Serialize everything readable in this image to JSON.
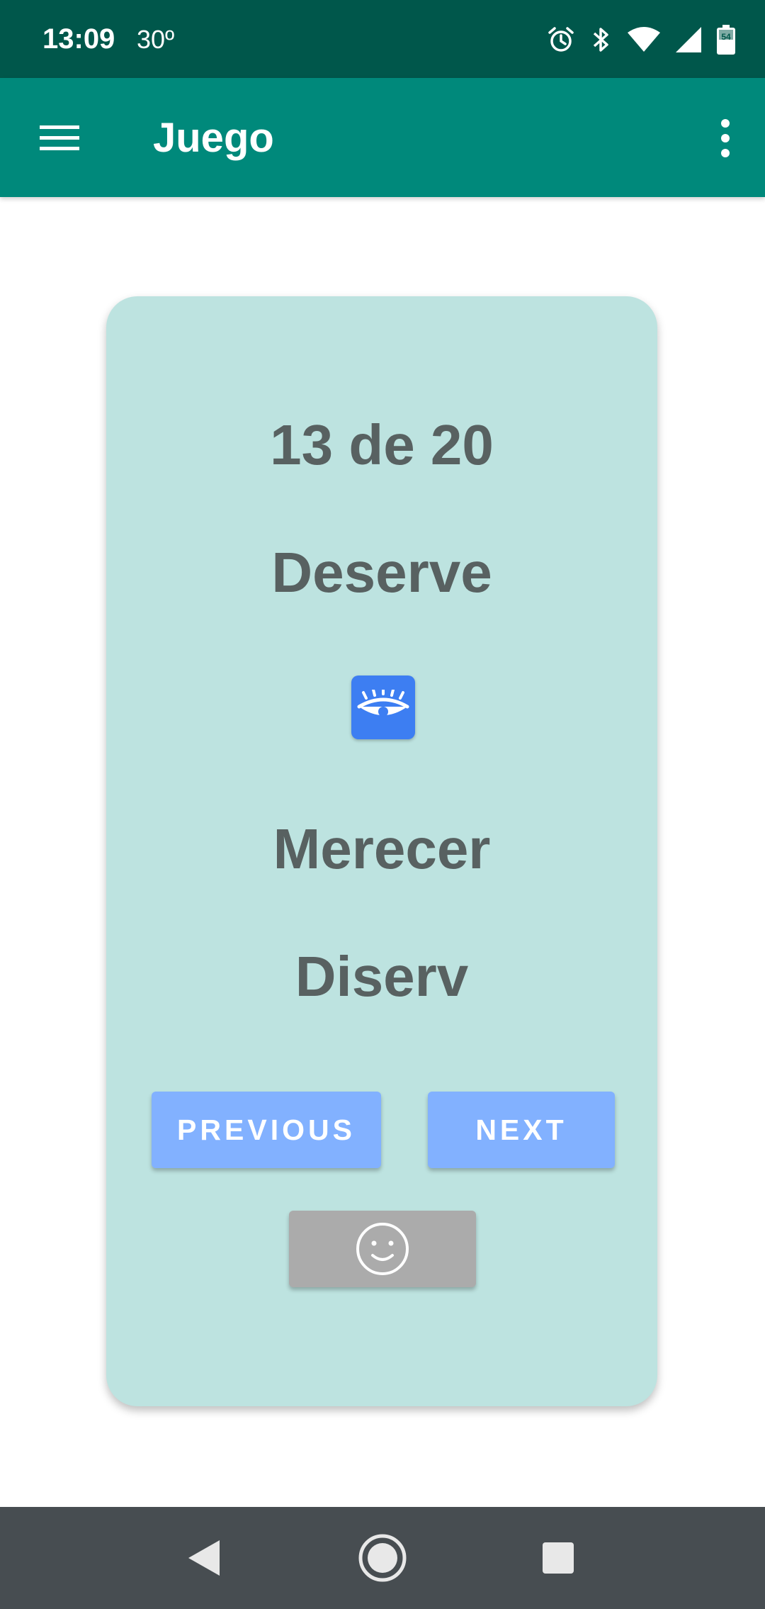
{
  "status_bar": {
    "time": "13:09",
    "temperature": "30º",
    "battery_level": "54",
    "icons": [
      "alarm-icon",
      "bluetooth-icon",
      "wifi-icon",
      "cell-signal-icon",
      "battery-icon"
    ]
  },
  "app_bar": {
    "title": "Juego",
    "menu_icon": "hamburger-menu-icon",
    "overflow_icon": "more-vert-icon"
  },
  "card": {
    "counter": "13 de 20",
    "word": "Deserve",
    "reveal_icon": "eye-icon",
    "translation": "Merecer",
    "phonetic": "Diserv",
    "previous_label": "PREVIOUS",
    "next_label": "NEXT",
    "feedback_icon": "smiley-face-icon"
  },
  "nav_bar": {
    "icons": [
      "back-icon",
      "home-icon",
      "recents-icon"
    ]
  },
  "colors": {
    "status_bar": "#00574b",
    "app_bar": "#00897b",
    "card_background": "#bde3e0",
    "card_text": "#586161",
    "reveal_button": "#3d7ef2",
    "nav_buttons": "#82b1ff",
    "feedback_button": "#ababab",
    "system_nav": "#474d51"
  }
}
